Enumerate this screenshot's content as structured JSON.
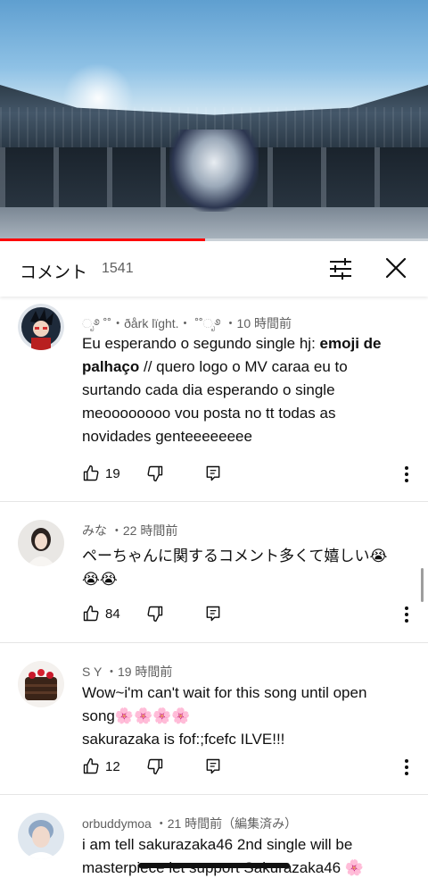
{
  "video": {
    "progress_fraction": 0.48
  },
  "header": {
    "title": "コメント",
    "count": "1541",
    "icons": {
      "filter": "tune-icon",
      "close": "close-icon"
    }
  },
  "comments": [
    {
      "author": "ೃ࿔ ˚˚・ðårk lïght.・ ˚˚ೃ࿔",
      "time": "・10 時間前",
      "text_before": "Eu esperando o segundo single hj: ",
      "text_bold": "emoji de palhaço",
      "text_after": " // quero logo o MV caraa eu to surtando cada dia esperando o single meoooooooo vou posta no tt todas as novidades genteeeeeeee",
      "likes": "19"
    },
    {
      "author": "みな",
      "time": "・22 時間前",
      "text": "ペーちゃんに関するコメント多くて嬉しい😭😭😭",
      "likes": "84"
    },
    {
      "author": "S Y",
      "time": "・19 時間前",
      "text_line1": "Wow~i'm can't wait for this song until open song🌸🌸🌸🌸",
      "text_line2": "sakurazaka is fof:;fcefc ILVE!!!",
      "likes": "12"
    },
    {
      "author": "orbuddymoa",
      "time": "・21 時間前（編集済み）",
      "text": "i am tell sakurazaka46 2nd single will be masterpiece let support Sakurazaka46 🌸"
    }
  ],
  "colors": {
    "progress": "#ff0000",
    "meta": "#606060",
    "divider": "#e5e5e5"
  }
}
